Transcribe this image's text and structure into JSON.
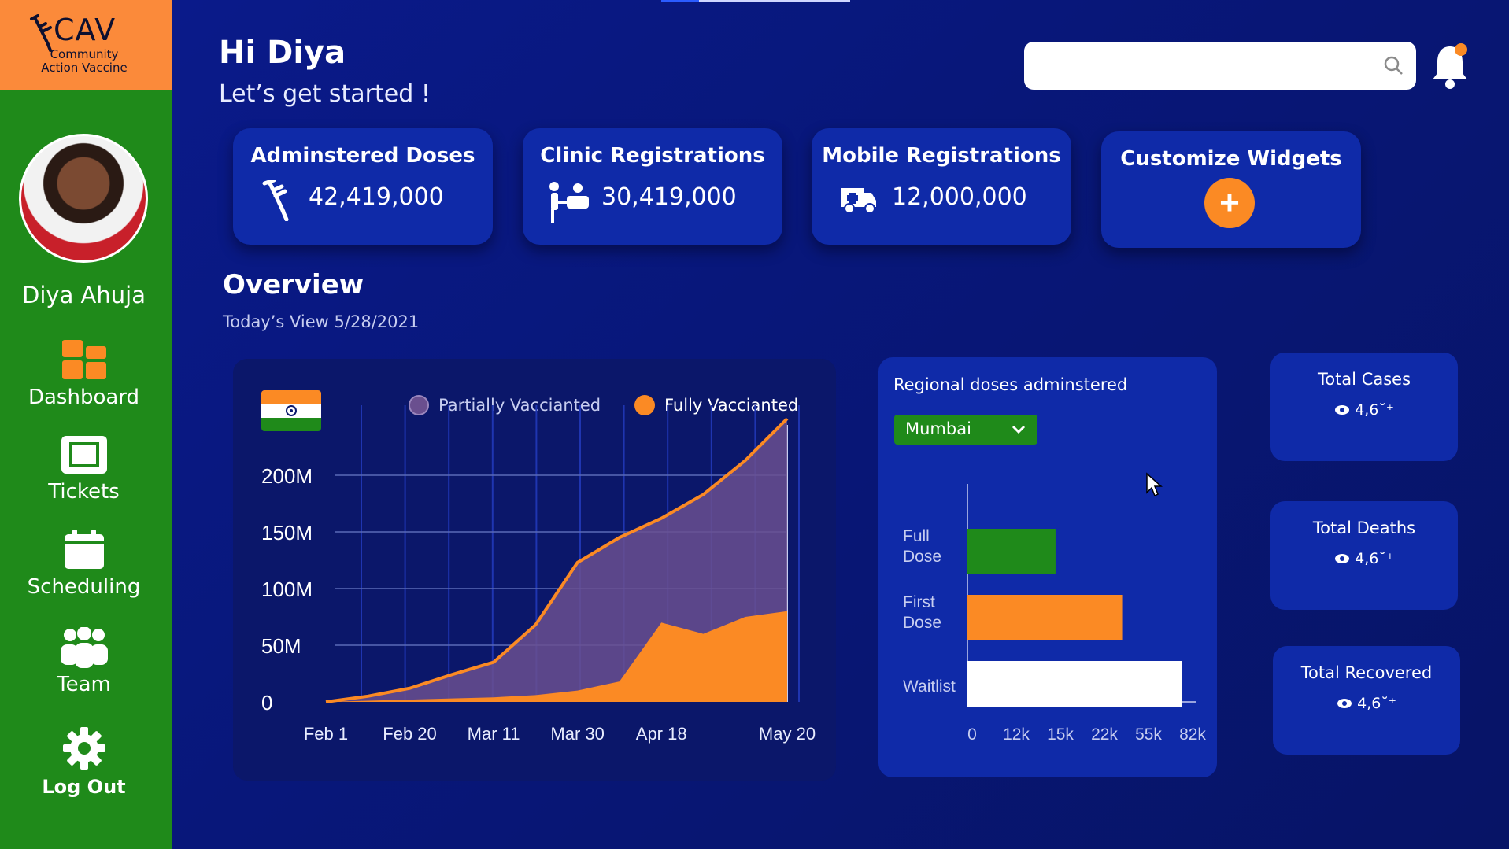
{
  "brand": {
    "logo_text": "CAV",
    "logo_sub": "Community Action Vaccine"
  },
  "user": {
    "name": "Diya Ahuja"
  },
  "nav": [
    {
      "label": "Dashboard",
      "icon": "dashboard-icon"
    },
    {
      "label": "Tickets",
      "icon": "tickets-icon"
    },
    {
      "label": "Scheduling",
      "icon": "calendar-icon"
    },
    {
      "label": "Team",
      "icon": "team-icon"
    },
    {
      "label": "Log Out",
      "icon": "gear-icon"
    }
  ],
  "header": {
    "greeting": "Hi Diya",
    "subtitle": "Let’s get started !",
    "search_placeholder": ""
  },
  "stats": [
    {
      "title": "Adminstered Doses",
      "value": "42,419,000",
      "icon": "syringe-icon"
    },
    {
      "title": "Clinic Registrations",
      "value": "30,419,000",
      "icon": "clinic-icon"
    },
    {
      "title": "Mobile Registrations",
      "value": "12,000,000",
      "icon": "ambulance-icon"
    },
    {
      "title": "Customize Widgets",
      "button": "+"
    }
  ],
  "overview": {
    "title": "Overview",
    "date": "Today’s View 5/28/2021"
  },
  "colors": {
    "accent": "#fb8a24",
    "green": "#1f8a1a",
    "panel": "#0f2aa8",
    "purple": "#6a4f8f"
  },
  "regional": {
    "title": "Regional doses adminstered",
    "selected_region": "Mumbai"
  },
  "side_stats": [
    {
      "title": "Total Cases",
      "value": "4,6˘⁺"
    },
    {
      "title": "Total Deaths",
      "value": "4,6˘⁺"
    },
    {
      "title": "Total Recovered",
      "value": "4,6˘⁺"
    }
  ],
  "chart_data": [
    {
      "type": "area",
      "title": "",
      "legend_placement": "top",
      "series": [
        {
          "name": "Partially Vaccianted",
          "color": "#6a4f8f",
          "x": [
            "Feb 1",
            "Feb 10",
            "Feb 20",
            "Mar 1",
            "Mar 11",
            "Mar 20",
            "Mar 30",
            "Apr 8",
            "Apr 18",
            "May 1",
            "May 10",
            "May 20"
          ],
          "values": [
            0,
            5,
            12,
            24,
            35,
            68,
            123,
            145,
            162,
            183,
            213,
            250
          ]
        },
        {
          "name": "Fully Vaccianted",
          "color": "#fb8a24",
          "x": [
            "Feb 1",
            "Feb 10",
            "Feb 20",
            "Mar 1",
            "Mar 11",
            "Mar 20",
            "Mar 30",
            "Apr 8",
            "Apr 18",
            "May 1",
            "May 10",
            "May 20"
          ],
          "values": [
            0,
            1,
            2,
            3,
            4,
            6,
            10,
            18,
            70,
            60,
            75,
            80
          ]
        }
      ],
      "x_tick_labels": [
        "Feb 1",
        "Feb 20",
        "Mar 11",
        "Mar 30",
        "Apr 18",
        "May 20"
      ],
      "y_tick_labels": [
        "0",
        "50M",
        "100M",
        "150M",
        "200M"
      ],
      "y_ticks": [
        0,
        50,
        100,
        150,
        200
      ],
      "ylim": [
        0,
        250
      ],
      "grid": true
    },
    {
      "type": "bar",
      "orientation": "horizontal",
      "categories": [
        "Full Dose",
        "First Dose",
        "Waitlist"
      ],
      "values": [
        0.41,
        0.72,
        1.0
      ],
      "colors": [
        "#1f8a1a",
        "#fb8a24",
        "#ffffff"
      ],
      "x_tick_labels": [
        "0",
        "12k",
        "15k",
        "22k",
        "55k",
        "82k"
      ]
    }
  ]
}
